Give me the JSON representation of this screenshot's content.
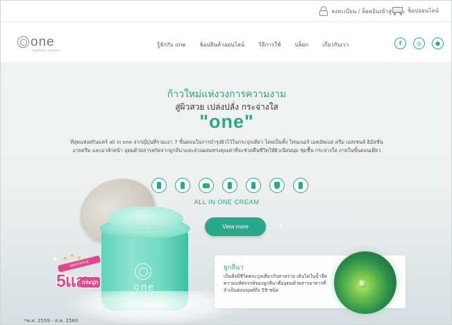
{
  "topbar": {
    "login_label": "ลงทะเบียน / ล็อคอินเข้าสู่ระบบ",
    "cart_label": "ช็อปออนไลน์",
    "login_icon": "lock-icon",
    "cart_icon": "cart-icon"
  },
  "header": {
    "logo_text": "one",
    "logo_tagline": "vegetable cosmetics",
    "nav": [
      {
        "label": "รู้จักกับ one"
      },
      {
        "label": "ช้อปสินค้าออนไลน์"
      },
      {
        "label": "วิธีการใช้"
      },
      {
        "label": "บล็อก"
      },
      {
        "label": "เกี่ยวกับเรา"
      }
    ],
    "social": [
      {
        "icon": "facebook-icon",
        "glyph": "f"
      },
      {
        "icon": "instagram-icon",
        "glyph": "◎"
      },
      {
        "icon": "line-icon",
        "glyph": "●"
      }
    ]
  },
  "hero": {
    "headline_line1": "ก้าวใหม่แห่งวงการความงาม",
    "headline_line2": "สู่ผิวสวย เปล่งปลั่ง กระจ่างใส",
    "headline_brand": "\"one\"",
    "description": "ที่สุดแห่งสกินแคร์ all in one จากญี่ปุ่นที่รวมเอา 7 ขั้นตอนในการบำรุงผิวไว้ในกระปุกเดียว โดยเป็นทั้ง โทนเนอร์ เมคอัพเบส ครีม เอสเซนส์ อิมัลชั่น อายครีม และมาส์กหน้า อุดมด้วยสารสกัดจากยูกลีนาและส่วนผสมทรงคุณค่าที่จะช่วยคืนชีวิตให้ผิวเนียนนุ่ม ชุ่มชื้น กระจ่างใส ภายในขั้นตอนเดียว",
    "product_icons": [
      "toner-icon",
      "base-icon",
      "cream-icon",
      "essence-icon",
      "emulsion-icon",
      "eye-cream-icon",
      "mask-icon"
    ],
    "all_in_one_label": "ALL IN ONE CREAM",
    "cta_label": "View more",
    "badge_ribbon": "ยอดขายทะลุ",
    "badge_big": "5แสน",
    "badge_small": "กระปุก",
    "jar_text": "one",
    "footnote": "*พ.ศ. 2559 - ส.ค. 2560"
  },
  "info_card": {
    "title": "ยูกลีนา",
    "text": "เป็นสิ่งมีชีวิตตระกูลเดียวกับสาหร่าย เติบโตในน้ำจืด ความมหัศจรรย์ของยูกลีนาคืออุดมด้วยสารอาหารที่จำเป็นต่อมนุษย์ถึง 59 ชนิด"
  },
  "colors": {
    "accent": "#2aa88c",
    "badge": "#e2478b",
    "cta_text": "#ffffff"
  }
}
